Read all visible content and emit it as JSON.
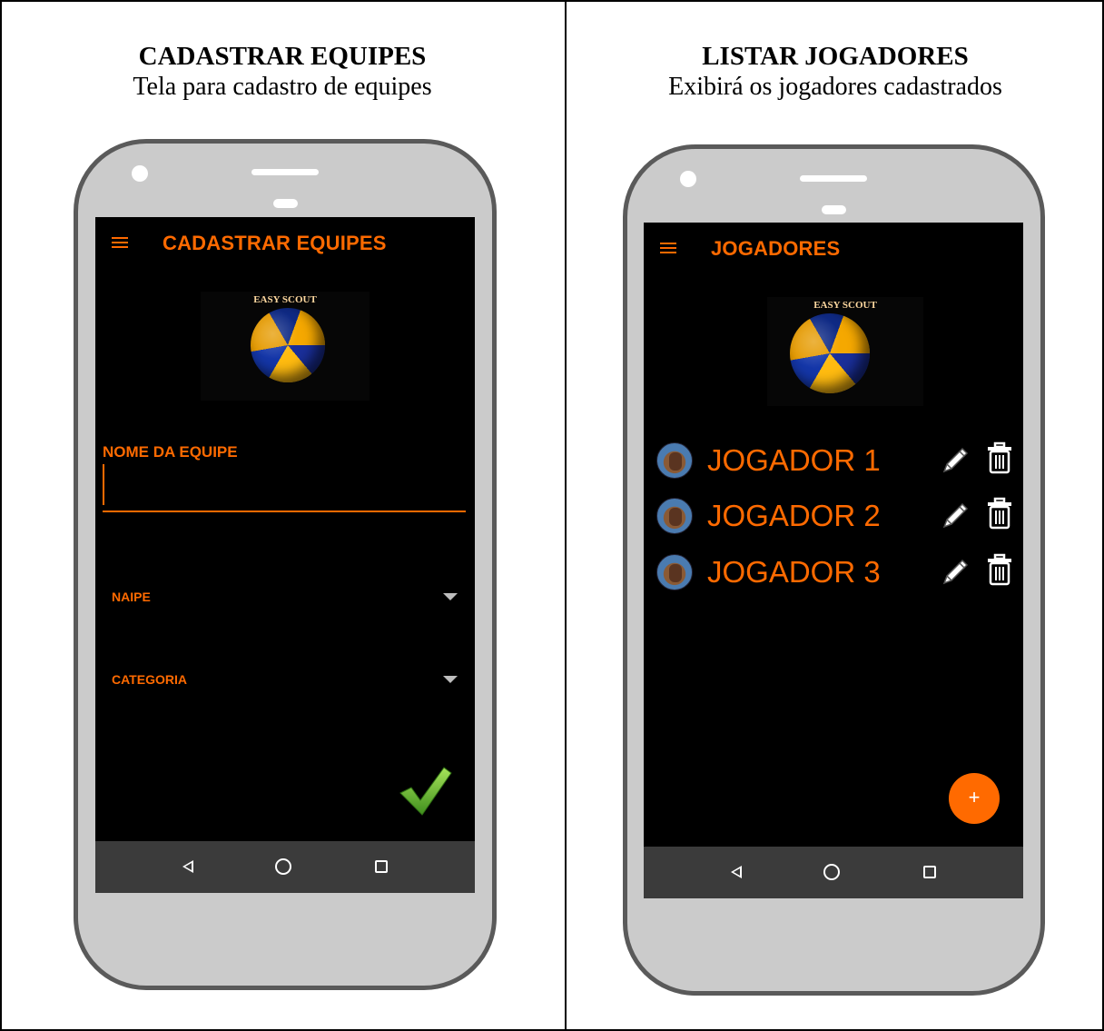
{
  "left_panel": {
    "heading": "CADASTRAR EQUIPES",
    "subheading": "Tela para cadastro de equipes",
    "app_bar_title": "CADASTRAR EQUIPES",
    "logo_text": "EASY SCOUT",
    "team_name_label": "NOME DA EQUIPE",
    "team_name_value": "",
    "naipe_label": "NAIPE",
    "categoria_label": "CATEGORIA",
    "confirm_icon": "checkmark-icon"
  },
  "right_panel": {
    "heading": "LISTAR JOGADORES",
    "subheading": "Exibirá os jogadores cadastrados",
    "app_bar_title": "JOGADORES",
    "logo_text": "EASY SCOUT",
    "players": [
      {
        "name": "JOGADOR 1"
      },
      {
        "name": "JOGADOR 2"
      },
      {
        "name": "JOGADOR 3"
      }
    ],
    "fab_label": "+"
  },
  "colors": {
    "accent": "#ff6a00",
    "screen_bg": "#000000",
    "phone_body": "#cbcbcb",
    "phone_border": "#5a5a5a",
    "nav_bar": "#3b3b3b"
  }
}
